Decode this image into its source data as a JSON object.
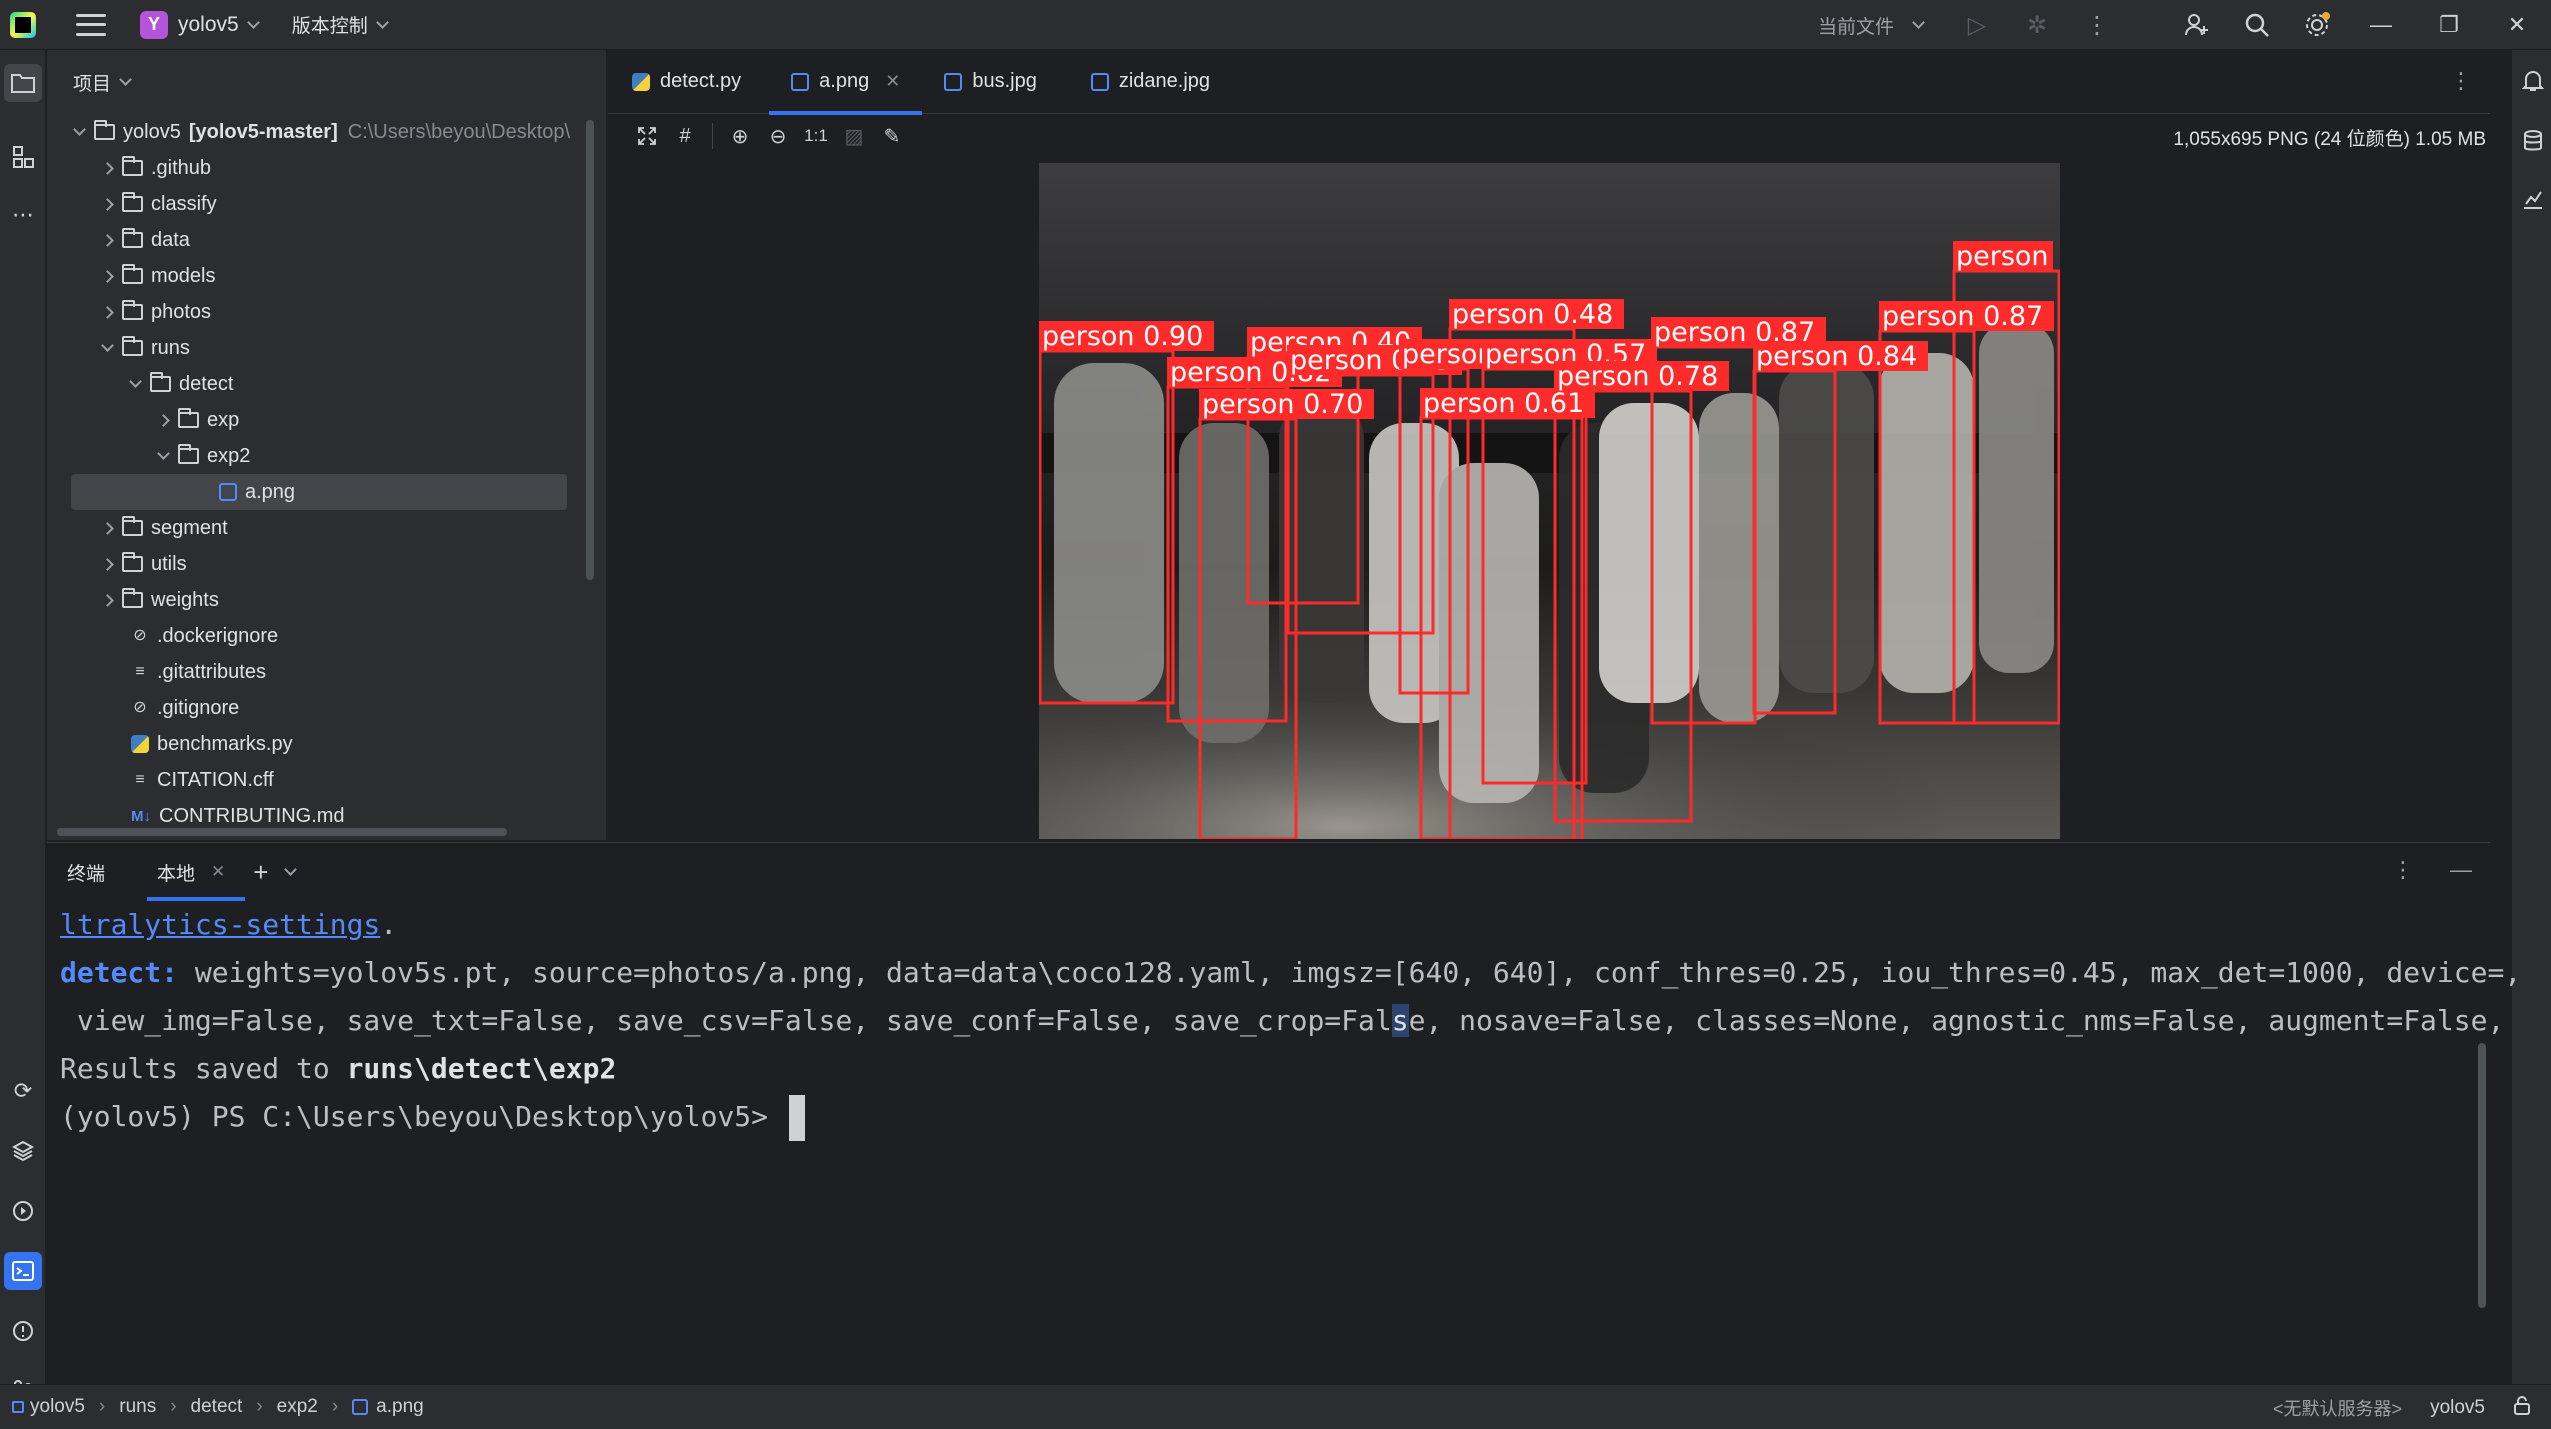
{
  "titlebar": {
    "project_badge": "Y",
    "project_name": "yolov5",
    "vcs_label": "版本控制",
    "current_file_label": "当前文件"
  },
  "project_panel": {
    "header": "项目",
    "items": [
      {
        "label": "yolov5",
        "suffix": "[yolov5-master]",
        "path": "C:\\Users\\beyou\\Desktop\\"
      },
      {
        "label": ".github"
      },
      {
        "label": "classify"
      },
      {
        "label": "data"
      },
      {
        "label": "models"
      },
      {
        "label": "photos"
      },
      {
        "label": "runs"
      },
      {
        "label": "detect"
      },
      {
        "label": "exp"
      },
      {
        "label": "exp2"
      },
      {
        "label": "a.png"
      },
      {
        "label": "segment"
      },
      {
        "label": "utils"
      },
      {
        "label": "weights"
      },
      {
        "label": ".dockerignore"
      },
      {
        "label": ".gitattributes"
      },
      {
        "label": ".gitignore"
      },
      {
        "label": "benchmarks.py"
      },
      {
        "label": "CITATION.cff"
      },
      {
        "label": "CONTRIBUTING.md"
      }
    ]
  },
  "editor": {
    "tabs": [
      {
        "label": "detect.py",
        "icon": "python-file-icon"
      },
      {
        "label": "a.png",
        "icon": "image-file-icon",
        "active": true
      },
      {
        "label": "bus.jpg",
        "icon": "image-file-icon"
      },
      {
        "label": "zidane.jpg",
        "icon": "image-file-icon"
      }
    ],
    "image_toolbar": {
      "actual_size_label": "1:1"
    },
    "image_info": "1,055x695 PNG (24 位颜色) 1.05 MB",
    "image": {
      "detections": [
        {
          "label": "person 0.90"
        },
        {
          "label": "person 0.82"
        },
        {
          "label": "person 0.70"
        },
        {
          "label": "person 0.40"
        },
        {
          "label": "person 0.75"
        },
        {
          "label": "person 0.57"
        },
        {
          "label": "person 0.48"
        },
        {
          "label": "person 0.57"
        },
        {
          "label": "person 0.61"
        },
        {
          "label": "person 0.78"
        },
        {
          "label": "person 0.87"
        },
        {
          "label": "person 0.84"
        },
        {
          "label": "person 0.87"
        },
        {
          "label": "person"
        }
      ]
    }
  },
  "terminal": {
    "tab_title": "终端",
    "session_tab": "本地",
    "lines": {
      "l1_link": "ltralytics-settings",
      "l1_end": ".",
      "l2_key": "detect:",
      "l2_rest": " weights=yolov5s.pt, source=photos/a.png, data=data\\coco128.yaml, imgsz=[640, 640], conf_thres=0.25, iou_thres=0.45, max_det=1000, device=,",
      "l3_a": " view_img=False, save_txt=False, save_csv=False, save_conf=False, save_crop=Fal",
      "l3_sel": "s",
      "l3_b": "e, nosave=False, classes=None, agnostic_nms=False, augment=False,",
      "l4_a": "Results saved to ",
      "l4_b": "runs\\detect\\exp2",
      "l5": "(yolov5) PS C:\\Users\\beyou\\Desktop\\yolov5> "
    }
  },
  "statusbar": {
    "breadcrumb": [
      "yolov5",
      "runs",
      "detect",
      "exp2",
      "a.png"
    ],
    "server": "<无默认服务器>",
    "interpreter": "yolov5"
  },
  "colors": {
    "accent": "#3574f0",
    "detection_box": "#ff2a2a",
    "background": "#1e1f22",
    "panel": "#2b2d30"
  }
}
